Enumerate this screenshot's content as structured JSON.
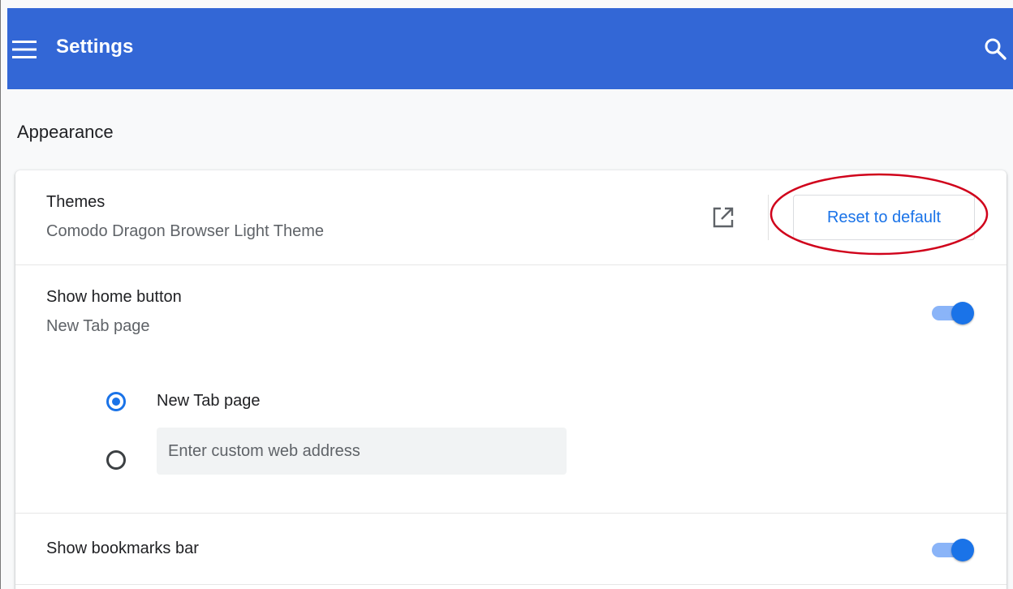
{
  "header": {
    "title": "Settings",
    "menu_icon": "hamburger-menu-icon",
    "search_icon": "search-icon",
    "background_color": "#3367d6"
  },
  "appearance": {
    "section_title": "Appearance",
    "themes": {
      "label": "Themes",
      "value": "Comodo Dragon Browser Light Theme",
      "open_icon": "open-in-new-icon",
      "reset_button_label": "Reset to default"
    },
    "home_button": {
      "label": "Show home button",
      "value": "New Tab page",
      "enabled": true,
      "options": [
        {
          "label": "New Tab page",
          "selected": true
        },
        {
          "placeholder": "Enter custom web address",
          "selected": false
        }
      ]
    },
    "bookmarks_bar": {
      "label": "Show bookmarks bar",
      "enabled": true
    }
  },
  "colors": {
    "accent": "#1a73e8",
    "annotation": "#d0021b"
  }
}
